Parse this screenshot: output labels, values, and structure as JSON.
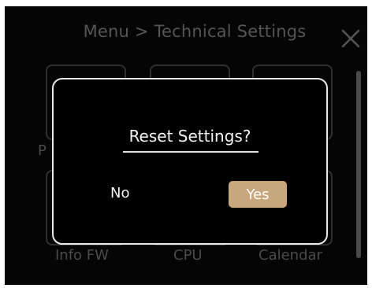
{
  "header": {
    "title": "Menu > Technical Settings",
    "close_icon": "close-icon"
  },
  "tiles": [
    {
      "label": "P",
      "icon": "blank-tile"
    },
    {
      "label": "",
      "icon": "blank-tile"
    },
    {
      "label": "",
      "icon": "blank-tile"
    },
    {
      "label": "Info FW",
      "icon": "blank-tile"
    },
    {
      "label": "CPU",
      "icon": "blank-tile"
    },
    {
      "label": "Calendar",
      "icon": "blank-tile"
    }
  ],
  "dialog": {
    "title": "Reset Settings?",
    "no_label": "No",
    "yes_label": "Yes"
  },
  "colors": {
    "background": "#050505",
    "dialog_border": "#e8e8e8",
    "accent": "#c9a77c",
    "dim_text": "#555555"
  }
}
